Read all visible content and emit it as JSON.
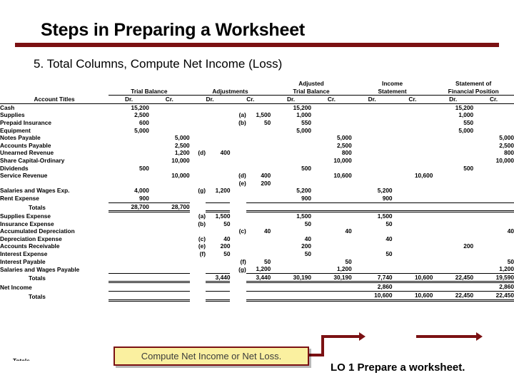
{
  "slide": {
    "title": "Steps in Preparing a Worksheet",
    "step": "5. Total Columns, Compute Net Income (Loss)",
    "lo_footer": "LO 1  Prepare a worksheet.",
    "cut_text": "Totals",
    "accent_color": "#7B1113",
    "callout_fill": "#FAF0A0"
  },
  "callout": {
    "text": "Compute Net Income or Net Loss."
  },
  "worksheet": {
    "title_column_header": "Account Titles",
    "groups": [
      {
        "label": "Trial Balance",
        "lines": [
          "",
          "Trial Balance"
        ]
      },
      {
        "label": "Adjustments",
        "lines": [
          "",
          "Adjustments"
        ]
      },
      {
        "label": "Adjusted Trial Balance",
        "lines": [
          "Adjusted",
          "Trial Balance"
        ]
      },
      {
        "label": "Income Statement",
        "lines": [
          "Income",
          "Statement"
        ]
      },
      {
        "label": "Statement of Financial Position",
        "lines": [
          "Statement of",
          "Financial Position"
        ]
      }
    ],
    "dr_label": "Dr.",
    "cr_label": "Cr.",
    "rows": [
      {
        "title": "Cash",
        "tb_dr": "15,200",
        "tb_cr": "",
        "adj_dr_ref": "",
        "adj_dr": "",
        "adj_cr_ref": "",
        "adj_cr": "",
        "atb_dr": "15,200",
        "atb_cr": "",
        "is_dr": "",
        "is_cr": "",
        "fp_dr": "15,200",
        "fp_cr": ""
      },
      {
        "title": "Supplies",
        "tb_dr": "2,500",
        "tb_cr": "",
        "adj_dr_ref": "",
        "adj_dr": "",
        "adj_cr_ref": "(a)",
        "adj_cr": "1,500",
        "atb_dr": "1,000",
        "atb_cr": "",
        "is_dr": "",
        "is_cr": "",
        "fp_dr": "1,000",
        "fp_cr": ""
      },
      {
        "title": "Prepaid Insurance",
        "tb_dr": "600",
        "tb_cr": "",
        "adj_dr_ref": "",
        "adj_dr": "",
        "adj_cr_ref": "(b)",
        "adj_cr": "50",
        "atb_dr": "550",
        "atb_cr": "",
        "is_dr": "",
        "is_cr": "",
        "fp_dr": "550",
        "fp_cr": ""
      },
      {
        "title": "Equipment",
        "tb_dr": "5,000",
        "tb_cr": "",
        "adj_dr_ref": "",
        "adj_dr": "",
        "adj_cr_ref": "",
        "adj_cr": "",
        "atb_dr": "5,000",
        "atb_cr": "",
        "is_dr": "",
        "is_cr": "",
        "fp_dr": "5,000",
        "fp_cr": ""
      },
      {
        "title": "Notes Payable",
        "tb_dr": "",
        "tb_cr": "5,000",
        "adj_dr_ref": "",
        "adj_dr": "",
        "adj_cr_ref": "",
        "adj_cr": "",
        "atb_dr": "",
        "atb_cr": "5,000",
        "is_dr": "",
        "is_cr": "",
        "fp_dr": "",
        "fp_cr": "5,000"
      },
      {
        "title": "Accounts Payable",
        "tb_dr": "",
        "tb_cr": "2,500",
        "adj_dr_ref": "",
        "adj_dr": "",
        "adj_cr_ref": "",
        "adj_cr": "",
        "atb_dr": "",
        "atb_cr": "2,500",
        "is_dr": "",
        "is_cr": "",
        "fp_dr": "",
        "fp_cr": "2,500"
      },
      {
        "title": "Unearned Revenue",
        "tb_dr": "",
        "tb_cr": "1,200",
        "adj_dr_ref": "(d)",
        "adj_dr": "400",
        "adj_cr_ref": "",
        "adj_cr": "",
        "atb_dr": "",
        "atb_cr": "800",
        "is_dr": "",
        "is_cr": "",
        "fp_dr": "",
        "fp_cr": "800"
      },
      {
        "title": "Share Capital-Ordinary",
        "tb_dr": "",
        "tb_cr": "10,000",
        "adj_dr_ref": "",
        "adj_dr": "",
        "adj_cr_ref": "",
        "adj_cr": "",
        "atb_dr": "",
        "atb_cr": "10,000",
        "is_dr": "",
        "is_cr": "",
        "fp_dr": "",
        "fp_cr": "10,000"
      },
      {
        "title": "Dividends",
        "tb_dr": "500",
        "tb_cr": "",
        "adj_dr_ref": "",
        "adj_dr": "",
        "adj_cr_ref": "",
        "adj_cr": "",
        "atb_dr": "500",
        "atb_cr": "",
        "is_dr": "",
        "is_cr": "",
        "fp_dr": "500",
        "fp_cr": ""
      },
      {
        "title": "Service Revenue",
        "tb_dr": "",
        "tb_cr": "10,000",
        "adj_dr_ref": "",
        "adj_dr": "",
        "adj_cr_ref": "(d)",
        "adj_cr": "400",
        "atb_dr": "",
        "atb_cr": "10,600",
        "is_dr": "",
        "is_cr": "10,600",
        "fp_dr": "",
        "fp_cr": ""
      },
      {
        "title": "",
        "tb_dr": "",
        "tb_cr": "",
        "adj_dr_ref": "",
        "adj_dr": "",
        "adj_cr_ref": "(e)",
        "adj_cr": "200",
        "atb_dr": "",
        "atb_cr": "",
        "is_dr": "",
        "is_cr": "",
        "fp_dr": "",
        "fp_cr": ""
      },
      {
        "title": "Salaries and Wages Exp.",
        "tb_dr": "4,000",
        "tb_cr": "",
        "adj_dr_ref": "(g)",
        "adj_dr": "1,200",
        "adj_cr_ref": "",
        "adj_cr": "",
        "atb_dr": "5,200",
        "atb_cr": "",
        "is_dr": "5,200",
        "is_cr": "",
        "fp_dr": "",
        "fp_cr": ""
      },
      {
        "title": "Rent Expense",
        "tb_dr": "900",
        "tb_cr": "",
        "adj_dr_ref": "",
        "adj_dr": "",
        "adj_cr_ref": "",
        "adj_cr": "",
        "atb_dr": "900",
        "atb_cr": "",
        "is_dr": "900",
        "is_cr": "",
        "fp_dr": "",
        "fp_cr": ""
      },
      {
        "title": "Totals",
        "indent": true,
        "rule": "total1",
        "tb_dr": "28,700",
        "tb_cr": "28,700",
        "adj_dr_ref": "",
        "adj_dr": "",
        "adj_cr_ref": "",
        "adj_cr": "",
        "atb_dr": "",
        "atb_cr": "",
        "is_dr": "",
        "is_cr": "",
        "fp_dr": "",
        "fp_cr": ""
      },
      {
        "title": "Supplies Expense",
        "tb_dr": "",
        "tb_cr": "",
        "adj_dr_ref": "(a)",
        "adj_dr": "1,500",
        "adj_cr_ref": "",
        "adj_cr": "",
        "atb_dr": "1,500",
        "atb_cr": "",
        "is_dr": "1,500",
        "is_cr": "",
        "fp_dr": "",
        "fp_cr": ""
      },
      {
        "title": "Insurance Expense",
        "tb_dr": "",
        "tb_cr": "",
        "adj_dr_ref": "(b)",
        "adj_dr": "50",
        "adj_cr_ref": "",
        "adj_cr": "",
        "atb_dr": "50",
        "atb_cr": "",
        "is_dr": "50",
        "is_cr": "",
        "fp_dr": "",
        "fp_cr": ""
      },
      {
        "title": "Accumulated Depreciation",
        "tb_dr": "",
        "tb_cr": "",
        "adj_dr_ref": "",
        "adj_dr": "",
        "adj_cr_ref": "(c)",
        "adj_cr": "40",
        "atb_dr": "",
        "atb_cr": "40",
        "is_dr": "",
        "is_cr": "",
        "fp_dr": "",
        "fp_cr": "40"
      },
      {
        "title": "Depreciation Expense",
        "tb_dr": "",
        "tb_cr": "",
        "adj_dr_ref": "(c)",
        "adj_dr": "40",
        "adj_cr_ref": "",
        "adj_cr": "",
        "atb_dr": "40",
        "atb_cr": "",
        "is_dr": "40",
        "is_cr": "",
        "fp_dr": "",
        "fp_cr": ""
      },
      {
        "title": "Accounts Receivable",
        "tb_dr": "",
        "tb_cr": "",
        "adj_dr_ref": "(e)",
        "adj_dr": "200",
        "adj_cr_ref": "",
        "adj_cr": "",
        "atb_dr": "200",
        "atb_cr": "",
        "is_dr": "",
        "is_cr": "",
        "fp_dr": "200",
        "fp_cr": ""
      },
      {
        "title": "Interest Expense",
        "tb_dr": "",
        "tb_cr": "",
        "adj_dr_ref": "(f)",
        "adj_dr": "50",
        "adj_cr_ref": "",
        "adj_cr": "",
        "atb_dr": "50",
        "atb_cr": "",
        "is_dr": "50",
        "is_cr": "",
        "fp_dr": "",
        "fp_cr": ""
      },
      {
        "title": "Interest Payable",
        "tb_dr": "",
        "tb_cr": "",
        "adj_dr_ref": "",
        "adj_dr": "",
        "adj_cr_ref": "(f)",
        "adj_cr": "50",
        "atb_dr": "",
        "atb_cr": "50",
        "is_dr": "",
        "is_cr": "",
        "fp_dr": "",
        "fp_cr": "50"
      },
      {
        "title": "Salaries and Wages Payable",
        "tb_dr": "",
        "tb_cr": "",
        "adj_dr_ref": "",
        "adj_dr": "",
        "adj_cr_ref": "(g)",
        "adj_cr": "1,200",
        "atb_dr": "",
        "atb_cr": "1,200",
        "is_dr": "",
        "is_cr": "",
        "fp_dr": "",
        "fp_cr": "1,200"
      },
      {
        "title": "Totals",
        "indent": true,
        "rule": "total2",
        "tb_dr": "",
        "tb_cr": "",
        "adj_dr_ref": "",
        "adj_dr": "3,440",
        "adj_cr_ref": "",
        "adj_cr": "3,440",
        "atb_dr": "30,190",
        "atb_cr": "30,190",
        "is_dr": "7,740",
        "is_cr": "10,600",
        "fp_dr": "22,450",
        "fp_cr": "19,590"
      },
      {
        "title": "Net Income",
        "rule": "netincome",
        "tb_dr": "",
        "tb_cr": "",
        "adj_dr_ref": "",
        "adj_dr": "",
        "adj_cr_ref": "",
        "adj_cr": "",
        "atb_dr": "",
        "atb_cr": "",
        "is_dr": "2,860",
        "is_cr": "",
        "fp_dr": "",
        "fp_cr": "2,860"
      },
      {
        "title": "Totals",
        "indent": true,
        "rule": "total3",
        "tb_dr": "",
        "tb_cr": "",
        "adj_dr_ref": "",
        "adj_dr": "",
        "adj_cr_ref": "",
        "adj_cr": "",
        "atb_dr": "",
        "atb_cr": "",
        "is_dr": "10,600",
        "is_cr": "10,600",
        "fp_dr": "22,450",
        "fp_cr": "22,450"
      }
    ]
  }
}
